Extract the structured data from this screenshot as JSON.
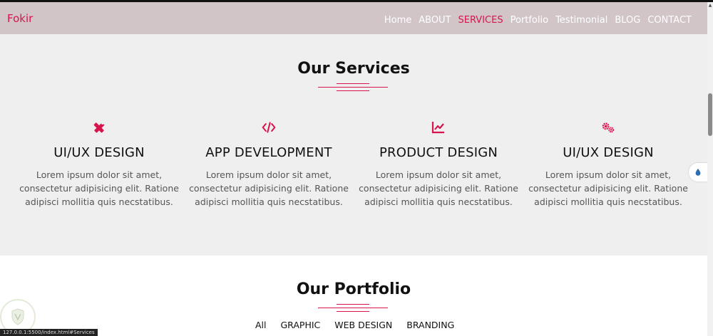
{
  "nav": {
    "brand": "Fokir",
    "links": [
      "Home",
      "ABOUT",
      "SERVICES",
      "Portfolio",
      "Testimonial",
      "BLOG",
      "CONTACT"
    ],
    "active": "SERVICES"
  },
  "services": {
    "title": "Our Services",
    "items": [
      {
        "icon": "pencil-ruler-icon",
        "title": "UI/UX DESIGN",
        "desc": "Lorem ipsum dolor sit amet, consectetur adipisicing elit. Ratione adipisci mollitia quis necstatibus."
      },
      {
        "icon": "code-icon",
        "title": "APP DEVELOPMENT",
        "desc": "Lorem ipsum dolor sit amet, consectetur adipisicing elit. Ratione adipisci mollitia quis necstatibus."
      },
      {
        "icon": "chart-line-icon",
        "title": "PRODUCT DESIGN",
        "desc": "Lorem ipsum dolor sit amet, consectetur adipisicing elit. Ratione adipisci mollitia quis necstatibus."
      },
      {
        "icon": "cogs-icon",
        "title": "UI/UX DESIGN",
        "desc": "Lorem ipsum dolor sit amet, consectetur adipisicing elit. Ratione adipisci mollitia quis necstatibus."
      }
    ]
  },
  "portfolio": {
    "title": "Our Portfolio",
    "filters": [
      "All",
      "GRAPHIC",
      "WEB DESIGN",
      "BRANDING"
    ]
  },
  "status_url": "127.0.0.1:5500/index.html#Services",
  "colors": {
    "accent": "#d8144d",
    "navbar": "#d1c5c8",
    "services_bg": "#f0efef"
  }
}
